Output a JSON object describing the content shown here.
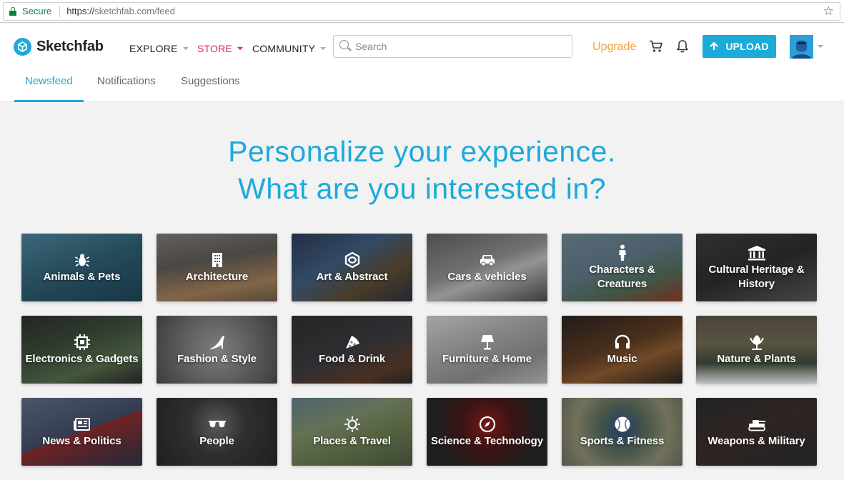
{
  "browser": {
    "secure_label": "Secure",
    "url_scheme": "https://",
    "url_host_path": "sketchfab.com/feed"
  },
  "header": {
    "logo_text": "Sketchfab",
    "nav": {
      "explore": "EXPLORE",
      "store": "STORE",
      "community": "COMMUNITY"
    },
    "search_placeholder": "Search",
    "upgrade_label": "Upgrade",
    "upload_label": "UPLOAD"
  },
  "tabs": {
    "newsfeed": "Newsfeed",
    "notifications": "Notifications",
    "suggestions": "Suggestions"
  },
  "hero": {
    "line1": "Personalize your experience.",
    "line2": "What are you interested in?"
  },
  "categories": [
    {
      "label": "Animals & Pets",
      "icon": "bug-icon"
    },
    {
      "label": "Architecture",
      "icon": "building-icon"
    },
    {
      "label": "Art & Abstract",
      "icon": "abstract-icon"
    },
    {
      "label": "Cars & vehicles",
      "icon": "car-icon"
    },
    {
      "label": "Characters & Creatures",
      "icon": "person-icon"
    },
    {
      "label": "Cultural Heritage & History",
      "icon": "museum-icon"
    },
    {
      "label": "Electronics & Gadgets",
      "icon": "chip-icon"
    },
    {
      "label": "Fashion & Style",
      "icon": "high-heel-icon"
    },
    {
      "label": "Food & Drink",
      "icon": "pizza-icon"
    },
    {
      "label": "Furniture & Home",
      "icon": "lamp-icon"
    },
    {
      "label": "Music",
      "icon": "headphones-icon"
    },
    {
      "label": "Nature & Plants",
      "icon": "flower-icon"
    },
    {
      "label": "News & Politics",
      "icon": "newspaper-icon"
    },
    {
      "label": "People",
      "icon": "sunglasses-icon"
    },
    {
      "label": "Places & Travel",
      "icon": "sun-icon"
    },
    {
      "label": "Science & Technology",
      "icon": "compass-icon"
    },
    {
      "label": "Sports & Fitness",
      "icon": "tennis-ball-icon"
    },
    {
      "label": "Weapons & Military",
      "icon": "tank-icon"
    }
  ],
  "colors": {
    "accent": "#1caad9",
    "store": "#e0245e",
    "upgrade": "#f0a33a"
  }
}
